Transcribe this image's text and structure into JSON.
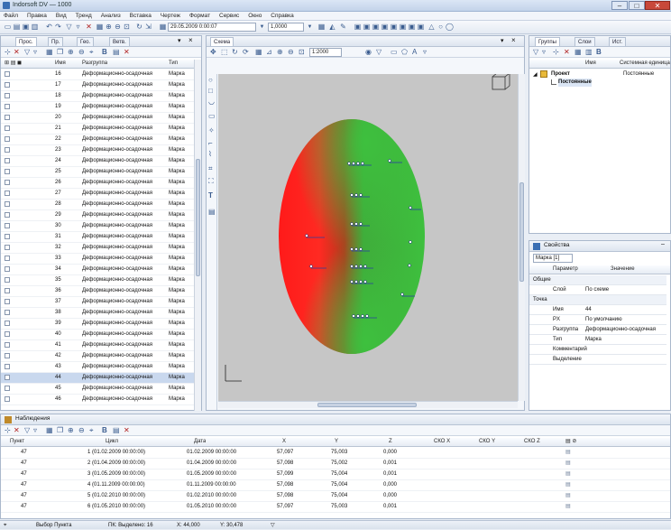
{
  "window": {
    "title": "Indorsoft DV — 1000",
    "min": "–",
    "max": "□",
    "close": "✕"
  },
  "menu": [
    "Файл",
    "Правка",
    "Вид",
    "Тренд",
    "Анализ",
    "Вставка",
    "Чертеж",
    "Формат",
    "Сервис",
    "Окно",
    "Справка"
  ],
  "toolbar": {
    "date_from": "29.05.2009 0:00:07",
    "scale": "1,0000"
  },
  "left_panel": {
    "tabs": [
      "Прос.",
      "Пр.",
      "Гео.",
      "Ветв."
    ],
    "columns": [
      "",
      "Имя",
      "Разгруппа",
      "Тип"
    ],
    "rows": [
      {
        "num": "16",
        "name": "Деформационно-осадочная",
        "type": "Марка"
      },
      {
        "num": "17",
        "name": "Деформационно-осадочная",
        "type": "Марка"
      },
      {
        "num": "18",
        "name": "Деформационно-осадочная",
        "type": "Марка"
      },
      {
        "num": "19",
        "name": "Деформационно-осадочная",
        "type": "Марка"
      },
      {
        "num": "20",
        "name": "Деформационно-осадочная",
        "type": "Марка"
      },
      {
        "num": "21",
        "name": "Деформационно-осадочная",
        "type": "Марка"
      },
      {
        "num": "22",
        "name": "Деформационно-осадочная",
        "type": "Марка"
      },
      {
        "num": "23",
        "name": "Деформационно-осадочная",
        "type": "Марка"
      },
      {
        "num": "24",
        "name": "Деформационно-осадочная",
        "type": "Марка"
      },
      {
        "num": "25",
        "name": "Деформационно-осадочная",
        "type": "Марка"
      },
      {
        "num": "26",
        "name": "Деформационно-осадочная",
        "type": "Марка"
      },
      {
        "num": "27",
        "name": "Деформационно-осадочная",
        "type": "Марка"
      },
      {
        "num": "28",
        "name": "Деформационно-осадочная",
        "type": "Марка"
      },
      {
        "num": "29",
        "name": "Деформационно-осадочная",
        "type": "Марка"
      },
      {
        "num": "30",
        "name": "Деформационно-осадочная",
        "type": "Марка"
      },
      {
        "num": "31",
        "name": "Деформационно-осадочная",
        "type": "Марка"
      },
      {
        "num": "32",
        "name": "Деформационно-осадочная",
        "type": "Марка"
      },
      {
        "num": "33",
        "name": "Деформационно-осадочная",
        "type": "Марка"
      },
      {
        "num": "34",
        "name": "Деформационно-осадочная",
        "type": "Марка"
      },
      {
        "num": "35",
        "name": "Деформационно-осадочная",
        "type": "Марка"
      },
      {
        "num": "36",
        "name": "Деформационно-осадочная",
        "type": "Марка"
      },
      {
        "num": "37",
        "name": "Деформационно-осадочная",
        "type": "Марка"
      },
      {
        "num": "38",
        "name": "Деформационно-осадочная",
        "type": "Марка"
      },
      {
        "num": "39",
        "name": "Деформационно-осадочная",
        "type": "Марка"
      },
      {
        "num": "40",
        "name": "Деформационно-осадочная",
        "type": "Марка"
      },
      {
        "num": "41",
        "name": "Деформационно-осадочная",
        "type": "Марка"
      },
      {
        "num": "42",
        "name": "Деформационно-осадочная",
        "type": "Марка"
      },
      {
        "num": "43",
        "name": "Деформационно-осадочная",
        "type": "Марка"
      },
      {
        "num": "44",
        "name": "Деформационно-осадочная",
        "type": "Марка"
      },
      {
        "num": "45",
        "name": "Деформационно-осадочная",
        "type": "Марка"
      },
      {
        "num": "46",
        "name": "Деформационно-осадочная",
        "type": "Марка"
      }
    ],
    "selected_row": "44"
  },
  "center_panel": {
    "tab": "Схема",
    "zoom": "1:2000"
  },
  "right_panel": {
    "tabs": [
      "Группы",
      "Слои",
      "Ист."
    ],
    "columns": [
      "Имя",
      "Системная единица"
    ],
    "tree": [
      {
        "label": "Проект",
        "value": "Постоянные"
      },
      {
        "label": "Постоянные",
        "value": ""
      }
    ]
  },
  "properties": {
    "title": "Свойства",
    "dropdown": "Марка [1]",
    "columns": [
      "Параметр",
      "Значение"
    ],
    "groups": [
      {
        "name": "Общие",
        "items": [
          {
            "label": "Слой",
            "value": "По схеме"
          }
        ]
      },
      {
        "name": "Точка",
        "items": [
          {
            "label": "Имя",
            "value": "44"
          },
          {
            "label": "PX",
            "value": "По умолчанию"
          },
          {
            "label": "Разгруппа",
            "value": "Деформационно-осадочная"
          },
          {
            "label": "Тип",
            "value": "Марка"
          },
          {
            "label": "Комментарий",
            "value": ""
          },
          {
            "label": "Выделение",
            "value": ""
          }
        ]
      }
    ]
  },
  "observations": {
    "title": "Наблюдения",
    "columns": [
      "Пункт",
      "Цикл",
      "Дата",
      "X",
      "Y",
      "Z",
      "СКО X",
      "СКО Y",
      "СКО Z"
    ],
    "rows": [
      {
        "point": "47",
        "cycle": "1 (01.02.2009 00:00:00)",
        "date": "01.02.2009 00:00:00",
        "x": "57,097",
        "y": "75,003",
        "z": "0,000"
      },
      {
        "point": "47",
        "cycle": "2 (01.04.2009 00:00:00)",
        "date": "01.04.2009 00:00:00",
        "x": "57,098",
        "y": "75,002",
        "z": "0,001"
      },
      {
        "point": "47",
        "cycle": "3 (01.05.2009 00:00:00)",
        "date": "01.05.2009 00:00:00",
        "x": "57,099",
        "y": "75,004",
        "z": "0,001"
      },
      {
        "point": "47",
        "cycle": "4 (01.11.2009 00:00:00)",
        "date": "01.11.2009 00:00:00",
        "x": "57,098",
        "y": "75,004",
        "z": "0,000"
      },
      {
        "point": "47",
        "cycle": "5 (01.02.2010 00:00:00)",
        "date": "01.02.2010 00:00:00",
        "x": "57,098",
        "y": "75,004",
        "z": "0,000"
      },
      {
        "point": "47",
        "cycle": "6 (01.05.2010 00:00:00)",
        "date": "01.05.2010 00:00:00",
        "x": "57,097",
        "y": "75,003",
        "z": "0,001"
      }
    ]
  },
  "status": {
    "left": "Выбор Пункта",
    "count": "ПК: Выделено: 16",
    "x": "X: 44,000",
    "y": "Y: 30,478"
  }
}
